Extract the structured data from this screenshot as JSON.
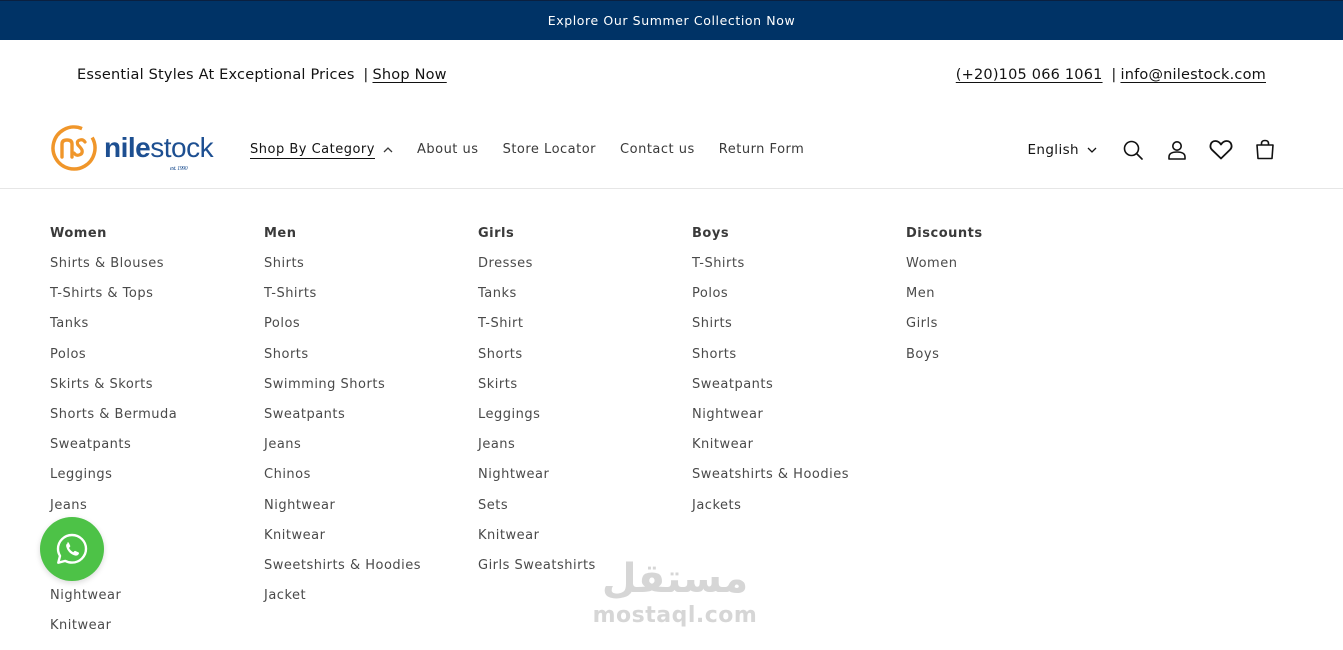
{
  "announcement": {
    "text": "Explore Our Summer Collection Now"
  },
  "utility": {
    "tagline": "Essential Styles At Exceptional Prices",
    "separator": "|",
    "shop_now": "Shop Now",
    "phone": "(+20)105 066 1061",
    "email": "info@nilestock.com"
  },
  "logo": {
    "wordmark_bold": "nile",
    "wordmark_rest": "stock",
    "est": "est. 1990"
  },
  "nav": [
    {
      "label": "Shop By Category",
      "active": true
    },
    {
      "label": "About us"
    },
    {
      "label": "Store Locator"
    },
    {
      "label": "Contact us"
    },
    {
      "label": "Return Form"
    }
  ],
  "header_right": {
    "language": "English"
  },
  "mega_menu": {
    "columns": [
      {
        "title": "Women",
        "items": [
          "Shirts & Blouses",
          "T-Shirts & Tops",
          "Tanks",
          "Polos",
          "Skirts & Skorts",
          "Shorts & Bermuda",
          "Sweatpants",
          "Leggings",
          "Jeans",
          "",
          "",
          "Nightwear",
          "Knitwear"
        ]
      },
      {
        "title": "Men",
        "items": [
          "Shirts",
          "T-Shirts",
          "Polos",
          "Shorts",
          "Swimming Shorts",
          "Sweatpants",
          "Jeans",
          "Chinos",
          "Nightwear",
          "Knitwear",
          "Sweetshirts & Hoodies",
          "Jacket"
        ]
      },
      {
        "title": "Girls",
        "items": [
          "Dresses",
          "Tanks",
          "T-Shirt",
          "Shorts",
          "Skirts",
          "Leggings",
          "Jeans",
          "Nightwear",
          "Sets",
          "Knitwear",
          "Girls Sweatshirts"
        ]
      },
      {
        "title": "Boys",
        "items": [
          "T-Shirts",
          "Polos",
          "Shirts",
          "Shorts",
          "Sweatpants",
          "Nightwear",
          "Knitwear",
          "Sweatshirts & Hoodies",
          "Jackets"
        ]
      },
      {
        "title": "Discounts",
        "items": [
          "Women",
          "Men",
          "Girls",
          "Boys"
        ]
      }
    ]
  },
  "watermark": {
    "arabic": "مستقل",
    "latin": "mostaql.com"
  },
  "colors": {
    "announcement_bg": "#003366",
    "whatsapp": "#4dc247",
    "logo_orange": "#f0962a",
    "logo_blue": "#1d4f91"
  }
}
